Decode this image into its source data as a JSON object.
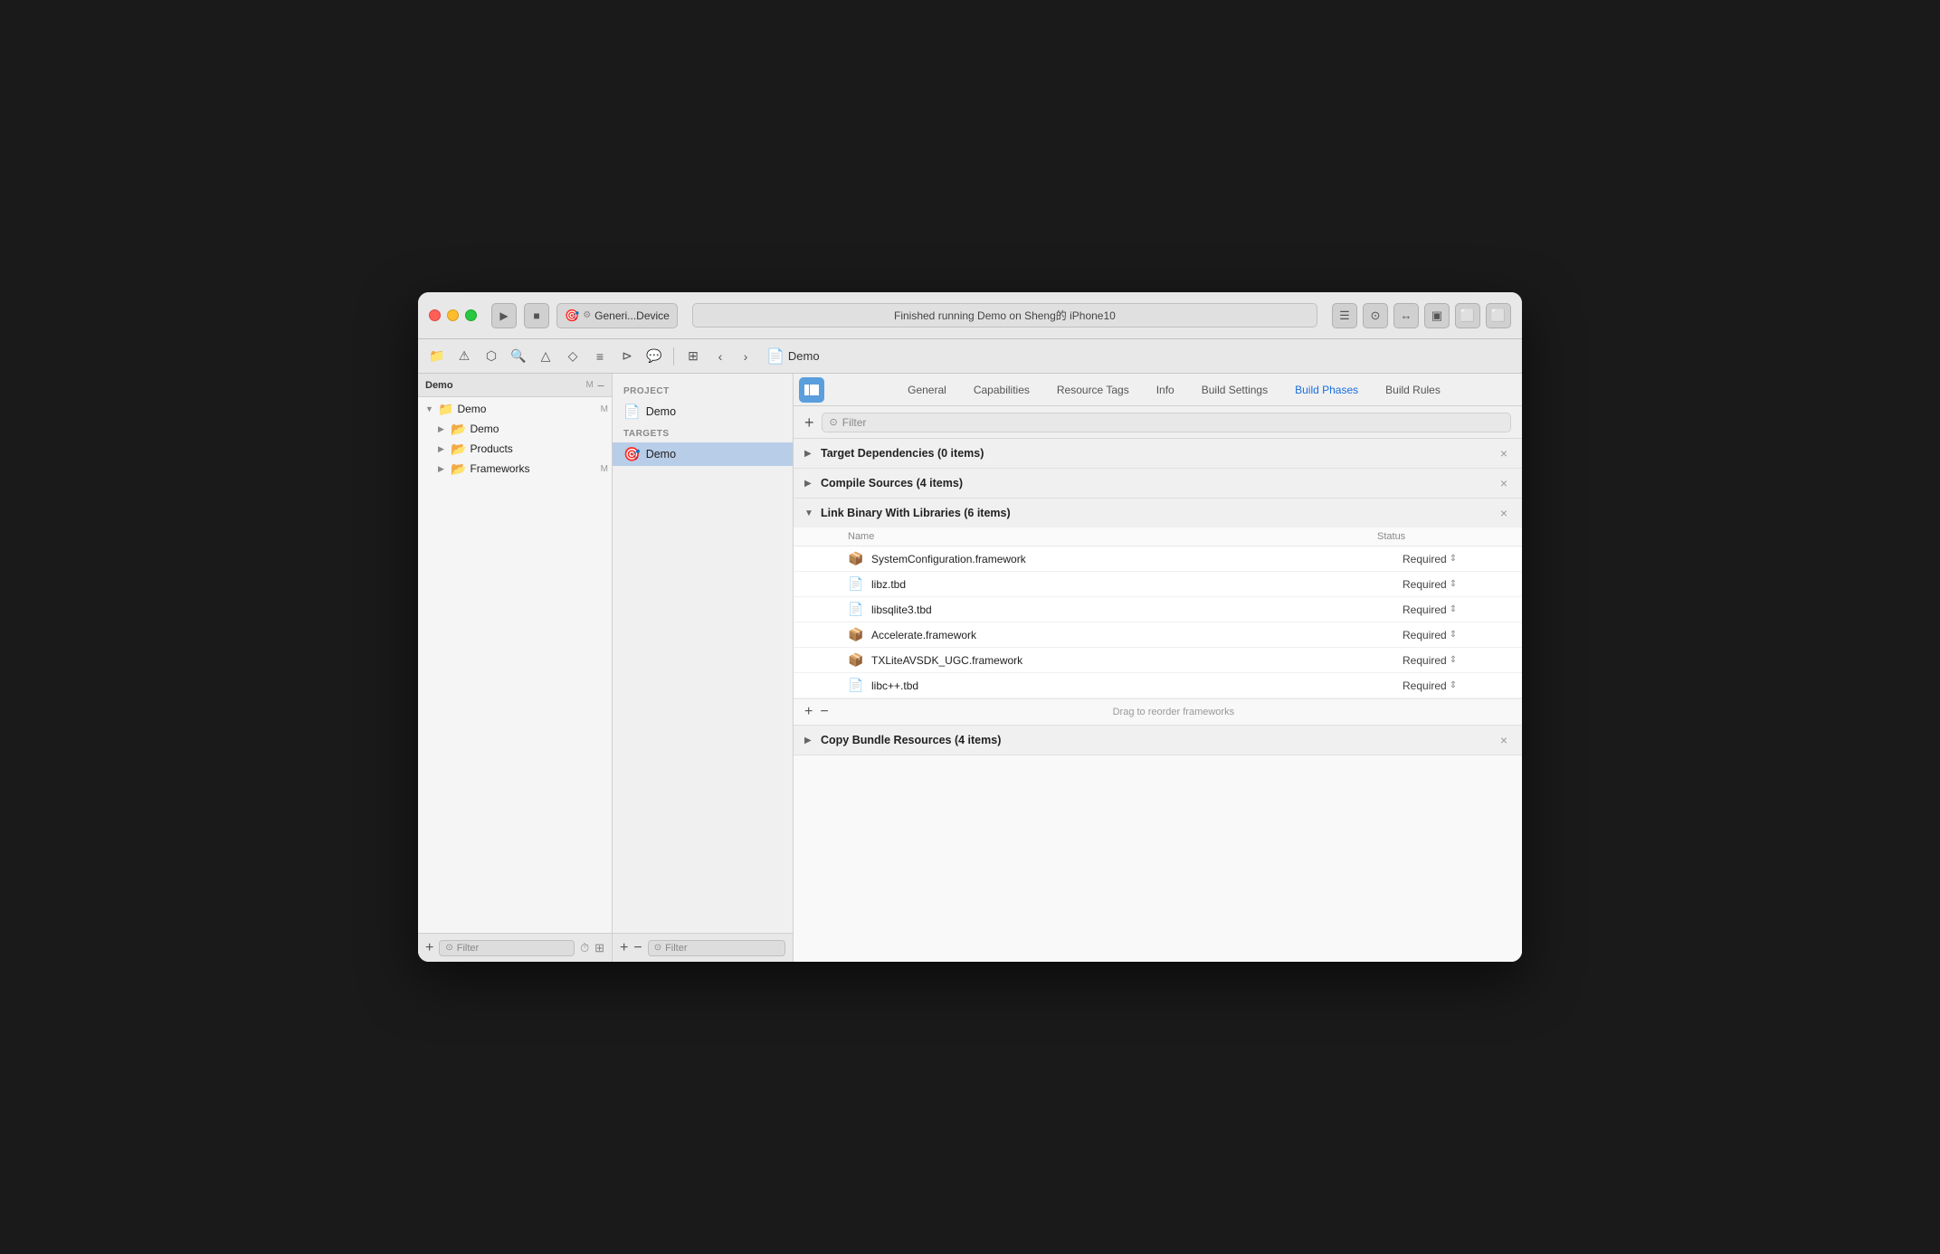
{
  "window": {
    "title": "Demo"
  },
  "titlebar": {
    "scheme": "Generi...Device",
    "status": "Finished running Demo on Sheng的 iPhone10",
    "buttons": {
      "run": "▶",
      "stop": "■"
    }
  },
  "toolbar": {
    "back": "‹",
    "forward": "›",
    "breadcrumb": "Demo"
  },
  "file_nav": {
    "header": "Demo",
    "badge": "M",
    "items": [
      {
        "label": "Demo",
        "type": "group",
        "indent": 0,
        "arrow": "▶"
      },
      {
        "label": "Demo",
        "type": "folder",
        "indent": 1,
        "arrow": "▶"
      },
      {
        "label": "Products",
        "type": "folder",
        "indent": 1,
        "arrow": "▶"
      },
      {
        "label": "Frameworks",
        "type": "folder",
        "indent": 1,
        "arrow": "▶",
        "badge": "M"
      }
    ],
    "filter_placeholder": "Filter"
  },
  "project_panel": {
    "project_label": "PROJECT",
    "project_items": [
      {
        "label": "Demo",
        "icon": "📄"
      }
    ],
    "targets_label": "TARGETS",
    "target_items": [
      {
        "label": "Demo",
        "icon": "🎯",
        "selected": true
      }
    ],
    "filter_placeholder": "Filter"
  },
  "tabs": {
    "items": [
      {
        "label": "General",
        "active": false
      },
      {
        "label": "Capabilities",
        "active": false
      },
      {
        "label": "Resource Tags",
        "active": false
      },
      {
        "label": "Info",
        "active": false
      },
      {
        "label": "Build Settings",
        "active": false
      },
      {
        "label": "Build Phases",
        "active": true
      },
      {
        "label": "Build Rules",
        "active": false
      }
    ]
  },
  "build_phases": {
    "filter_placeholder": "Filter",
    "phases": [
      {
        "title": "Target Dependencies (0 items)",
        "expanded": false,
        "arrow": "▶"
      },
      {
        "title": "Compile Sources (4 items)",
        "expanded": false,
        "arrow": "▶"
      },
      {
        "title": "Link Binary With Libraries (6 items)",
        "expanded": true,
        "arrow": "▼",
        "columns": {
          "name": "Name",
          "status": "Status"
        },
        "items": [
          {
            "name": "SystemConfiguration.framework",
            "status": "Required",
            "icon": "framework"
          },
          {
            "name": "libz.tbd",
            "status": "Required",
            "icon": "doc"
          },
          {
            "name": "libsqlite3.tbd",
            "status": "Required",
            "icon": "doc"
          },
          {
            "name": "Accelerate.framework",
            "status": "Required",
            "icon": "framework"
          },
          {
            "name": "TXLiteAVSDK_UGC.framework",
            "status": "Required",
            "icon": "framework"
          },
          {
            "name": "libc++.tbd",
            "status": "Required",
            "icon": "doc"
          }
        ],
        "footer": "Drag to reorder frameworks"
      },
      {
        "title": "Copy Bundle Resources (4 items)",
        "expanded": false,
        "arrow": "▶"
      }
    ]
  }
}
